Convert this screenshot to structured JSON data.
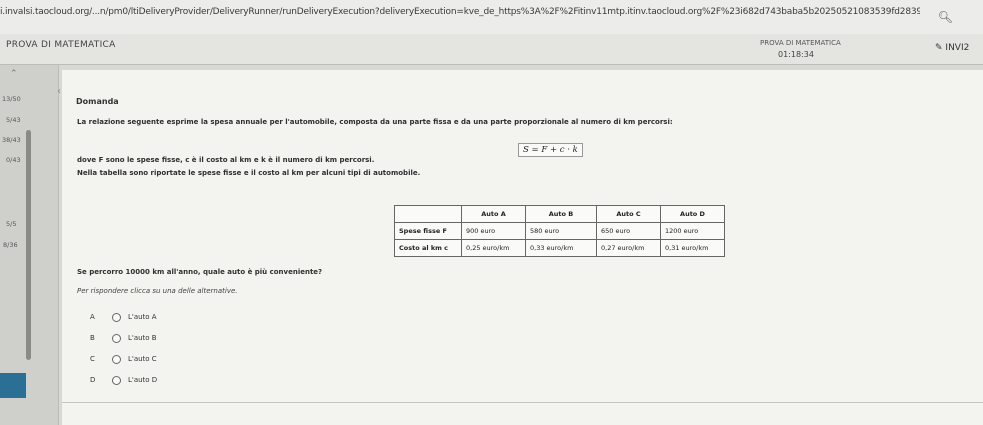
{
  "browser": {
    "url": "i.invalsi.taocloud.org/...n/pm0/ltiDeliveryProvider/DeliveryRunner/runDeliveryExecution?deliveryExecution=kve_de_https%3A%2F%2Fitinv11mtp.itinv.taocloud.org%2F%23i682d743baba5b20250521083539fd2839b6",
    "zoom_icon": "search-icon"
  },
  "header": {
    "app_title": "PROVA DI MATEMATICA",
    "test_name": "PROVA DI MATEMATICA",
    "timer": "01:18:34",
    "send_label": "INVI2"
  },
  "sidebar": {
    "items": [
      "13/50",
      "5/43",
      "38/43",
      "0/43",
      "5/5",
      "8/36"
    ]
  },
  "question": {
    "section_title": "Domanda",
    "intro": "La relazione seguente esprime la spesa annuale per l'automobile, composta da una parte fissa e da una parte proporzionale al numero di km percorsi:",
    "formula": "S = F + c · k",
    "definitions": "dove F sono le spese fisse, c è il costo al km e k è il numero di km percorsi.",
    "table_intro": "Nella tabella sono riportate le spese fisse e il costo al km per alcuni tipi di automobile.",
    "prompt": "Se percorro 10000 km all'anno, quale auto è più conveniente?",
    "instruction": "Per rispondere clicca su una delle alternative."
  },
  "table": {
    "headers": [
      "",
      "Auto A",
      "Auto B",
      "Auto C",
      "Auto D"
    ],
    "rows": [
      [
        "Spese fisse F",
        "900 euro",
        "580 euro",
        "650 euro",
        "1200 euro"
      ],
      [
        "Costo al km c",
        "0,25 euro/km",
        "0,33 euro/km",
        "0,27 euro/km",
        "0,31 euro/km"
      ]
    ]
  },
  "options": [
    {
      "letter": "A",
      "label": "L'auto A"
    },
    {
      "letter": "B",
      "label": "L'auto B"
    },
    {
      "letter": "C",
      "label": "L'auto C"
    },
    {
      "letter": "D",
      "label": "L'auto D"
    }
  ],
  "colors": {
    "accent": "#2c6f95"
  }
}
